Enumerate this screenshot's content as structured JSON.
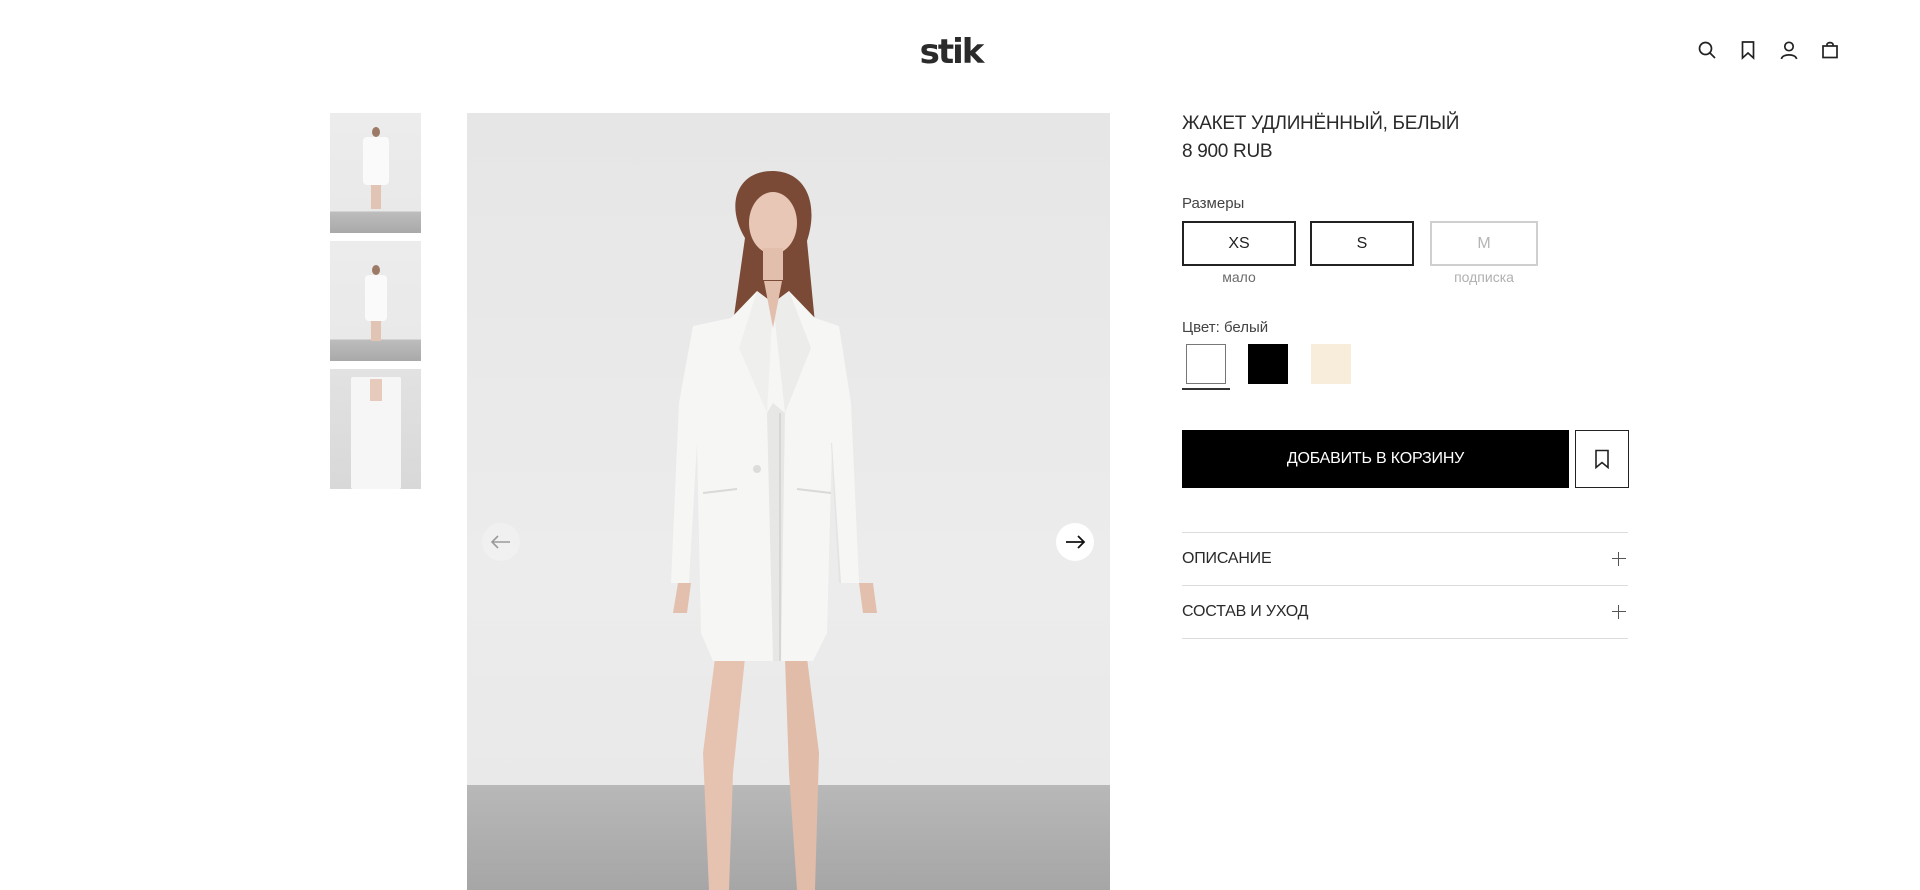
{
  "header": {
    "logo_text": "stik",
    "icons": [
      "search-icon",
      "bookmark-icon",
      "user-icon",
      "bag-icon"
    ]
  },
  "gallery": {
    "thumbnails": [
      "thumb-1",
      "thumb-2",
      "thumb-3"
    ],
    "prev_icon": "arrow-left-icon",
    "next_icon": "arrow-right-icon"
  },
  "product": {
    "title": "ЖАКЕТ УДЛИНЁННЫЙ, БЕЛЫЙ",
    "price": "8 900 RUB",
    "sizes_label": "Размеры",
    "sizes": [
      {
        "label": "XS",
        "note": "мало",
        "available": true
      },
      {
        "label": "S",
        "note": "",
        "available": true
      },
      {
        "label": "M",
        "note": "подписка",
        "available": false
      }
    ],
    "color_label": "Цвет: белый",
    "colors": [
      {
        "name": "white",
        "hex": "#ffffff",
        "selected": true
      },
      {
        "name": "black",
        "hex": "#000000",
        "selected": false
      },
      {
        "name": "cream",
        "hex": "#f8ecdb",
        "selected": false
      }
    ],
    "add_to_cart": "ДОБАВИТЬ В КОРЗИНУ",
    "accordion": [
      {
        "label": "ОПИСАНИЕ"
      },
      {
        "label": "СОСТАВ И УХОД"
      }
    ]
  }
}
